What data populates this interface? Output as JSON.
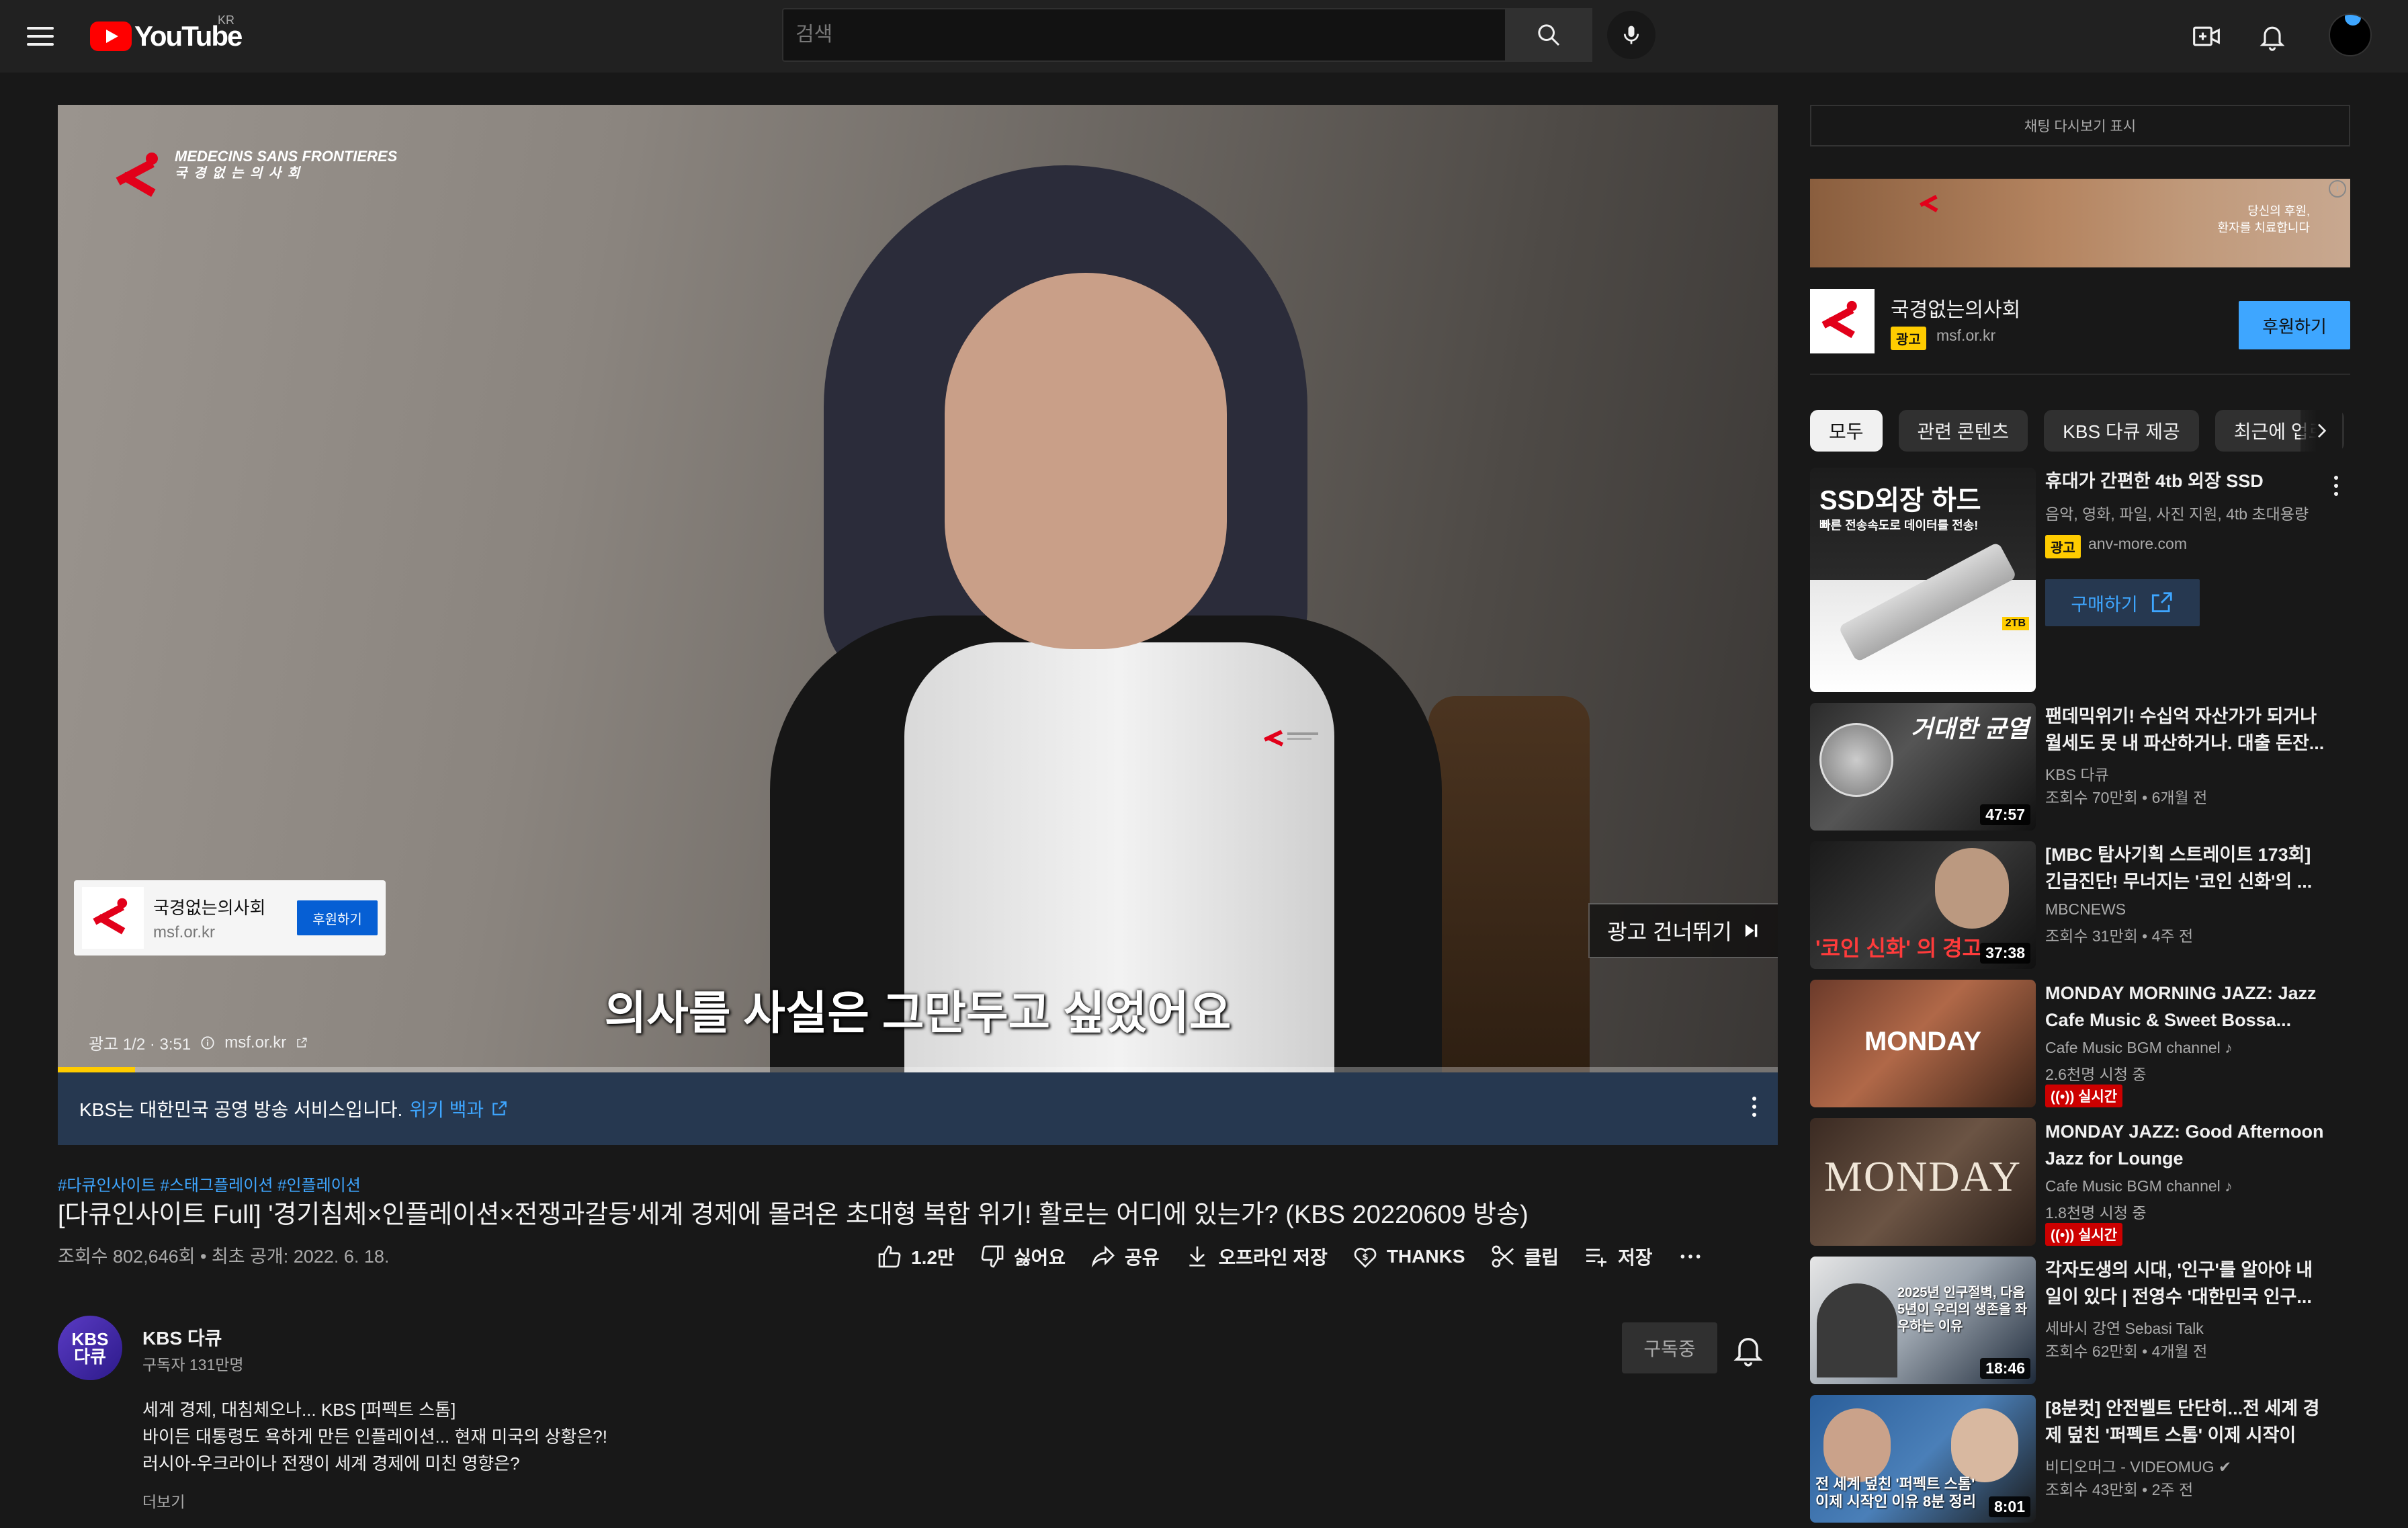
{
  "header": {
    "logo_text": "YouTube",
    "country_code": "KR",
    "search_placeholder": "검색"
  },
  "player": {
    "brand_en": "MEDECINS SANS FRONTIERES",
    "brand_ko": "국 경 없 는 의 사 회",
    "subtitle": "의사를 사실은 그만두고 싶었어요",
    "ad_card": {
      "name": "국경없는의사회",
      "domain": "msf.or.kr",
      "button": "후원하기"
    },
    "skip_label": "광고 건너뛰기",
    "ad_counter": "광고 1/2 · 3:51",
    "ad_domain": "msf.or.kr",
    "progress": 0.045
  },
  "info_bar": {
    "text": "KBS는 대한민국 공영 방송 서비스입니다.",
    "link": "위키 백과"
  },
  "video": {
    "hashtags": "#다큐인사이트 #스태그플레이션 #인플레이션",
    "title": "[다큐인사이트 Full] '경기침체×인플레이션×전쟁과갈등'세계 경제에 몰려온 초대형 복합 위기! 활로는 어디에 있는가? (KBS 20220609 방송)",
    "stats": "조회수 802,646회 • 최초 공개: 2022. 6. 18."
  },
  "actions": {
    "like": "1.2만",
    "dislike": "싫어요",
    "share": "공유",
    "download": "오프라인 저장",
    "thanks": "THANKS",
    "clip": "클립",
    "save": "저장"
  },
  "channel": {
    "avatar_line1": "KBS",
    "avatar_line2": "다큐",
    "name": "KBS 다큐",
    "subscribers": "구독자 131만명",
    "subscribe_label": "구독중"
  },
  "description": {
    "lines": [
      "세계 경제, 대침체오나... KBS [퍼펙트 스톰]",
      "바이든 대통령도 욕하게 만든 인플레이션... 현재 미국의 상황은?!",
      "러시아-우크라이나 전쟁이 세계 경제에 미친 영향은?"
    ],
    "more": "더보기"
  },
  "sidebar": {
    "chat_replay": "채팅 다시보기 표시",
    "banner_text": "당신의 후원,\n환자를 치료합니다",
    "ad": {
      "name": "국경없는의사회",
      "badge": "광고",
      "domain": "msf.or.kr",
      "button": "후원하기"
    },
    "chips": [
      "모두",
      "관련 콘텐츠",
      "KBS 다큐 제공",
      "최근에 업로"
    ],
    "promo": {
      "thumb_title": "SSD외장 하드",
      "thumb_sub": "빠른 전송속도로 데이터를 전송!",
      "thumb_tag": "2TB",
      "title": "휴대가 간편한 4tb 외장 SSD",
      "desc": "음악, 영화, 파일, 사진 지원, 4tb 초대용량",
      "badge": "광고",
      "domain": "anv-more.com",
      "button": "구매하기"
    },
    "recommendations": [
      {
        "title": "팬데믹위기! 수십억 자산가가 되거나 월세도 못 내 파산하거나. 대출 돈잔...",
        "channel": "KBS 다큐",
        "meta": "조회수 70만회 • 6개월 전",
        "duration": "47:57",
        "live": "",
        "thumb_text": "거대한 균열"
      },
      {
        "title": "[MBC 탐사기획 스트레이트 173회] 긴급진단! 무너지는 '코인 신화'의 ...",
        "channel": "MBCNEWS",
        "meta": "조회수 31만회 • 4주 전",
        "duration": "37:38",
        "live": "",
        "thumb_text": "'코인 신화' 의 경고"
      },
      {
        "title": "MONDAY MORNING JAZZ: Jazz Cafe Music & Sweet Bossa...",
        "channel": "Cafe Music BGM channel",
        "meta": "2.6천명 시청 중",
        "duration": "",
        "live": "실시간",
        "thumb_text": "MONDAY"
      },
      {
        "title": "MONDAY JAZZ: Good Afternoon Jazz for Lounge",
        "channel": "Cafe Music BGM channel",
        "meta": "1.8천명 시청 중",
        "duration": "",
        "live": "실시간",
        "thumb_text": "MONDAY"
      },
      {
        "title": "각자도생의 시대, '인구'를 알아야 내 일이 있다 | 전영수 '대한민국 인구...",
        "channel": "세바시 강연 Sebasi Talk",
        "meta": "조회수 62만회 • 4개월 전",
        "duration": "18:46",
        "live": "",
        "thumb_text": "2025년 인구절벽, 다음 5년이 우리의 생존을 좌우하는 이유"
      },
      {
        "title": "[8분컷] 안전벨트 단단히...전 세계 경제 덮친 '퍼펙트 스톰' 이제 시작이다...",
        "channel": "비디오머그 - VIDEOMUG",
        "meta": "조회수 43만회 • 2주 전",
        "duration": "8:01",
        "live": "",
        "thumb_text": "전 세계 덮친 '퍼펙트 스톰' 이제 시작인 이유 8분 정리"
      }
    ]
  }
}
